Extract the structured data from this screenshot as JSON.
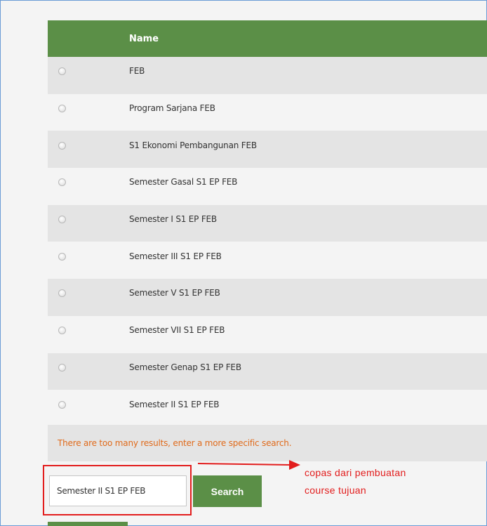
{
  "table": {
    "header": "Name",
    "rows": [
      "FEB",
      "Program Sarjana FEB",
      "S1 Ekonomi Pembangunan FEB",
      "Semester Gasal S1 EP FEB",
      "Semester I S1 EP FEB",
      "Semester III S1 EP FEB",
      "Semester V S1 EP FEB",
      "Semester VII S1 EP FEB",
      "Semester Genap S1 EP FEB",
      "Semester II S1 EP FEB"
    ]
  },
  "warning": "There are too many results, enter a more specific search.",
  "search": {
    "value": "Semester II S1 EP FEB",
    "button_label": "Search"
  },
  "annotation": {
    "line1": "copas dari pembuatan",
    "line2": "course tujuan",
    "color": "#e21d1d"
  },
  "colors": {
    "header_green": "#5b8f47",
    "warning_orange": "#e06a1a"
  }
}
